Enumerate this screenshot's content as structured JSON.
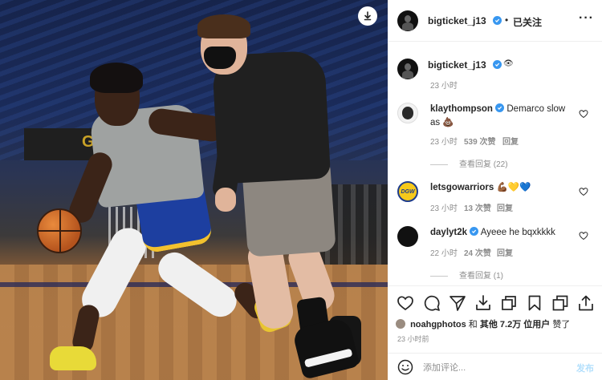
{
  "header": {
    "username": "bigticket_j13",
    "separator": "•",
    "follow_status": "已关注",
    "more_icon": "more-horizontal-icon"
  },
  "caption": {
    "username": "bigticket_j13",
    "caption_emoji": "👁",
    "time": "23 小时"
  },
  "comments": [
    {
      "username": "klaythompson",
      "verified": true,
      "text": "Demarco slow as 💩",
      "time": "23 小时",
      "likes": "539 次赞",
      "reply": "回复",
      "view_replies": "查看回复 (22)"
    },
    {
      "username": "letsgowarriors",
      "verified": false,
      "text": "💪🏾💛💙",
      "time": "23 小时",
      "likes": "13 次赞",
      "reply": "回复",
      "avatar_text": "DGW"
    },
    {
      "username": "daylyt2k",
      "verified": true,
      "text": "Ayeee he bqxkkkk",
      "time": "22 小时",
      "likes": "24 次赞",
      "reply": "回复",
      "view_replies": "查看回复 (1)"
    }
  ],
  "liked_by": {
    "user": "noahgphotos",
    "connector": "和",
    "others": "其他 7.2万 位用户",
    "suffix": "赞了"
  },
  "post_time": "23 小时前",
  "comment_box": {
    "placeholder": "添加评论...",
    "post_label": "发布"
  },
  "photo": {
    "scoreboard_text": "GA"
  },
  "colors": {
    "verified_blue": "#3897f0",
    "muted_text": "#8e8e8e",
    "post_button_disabled": "#b2dffc"
  }
}
